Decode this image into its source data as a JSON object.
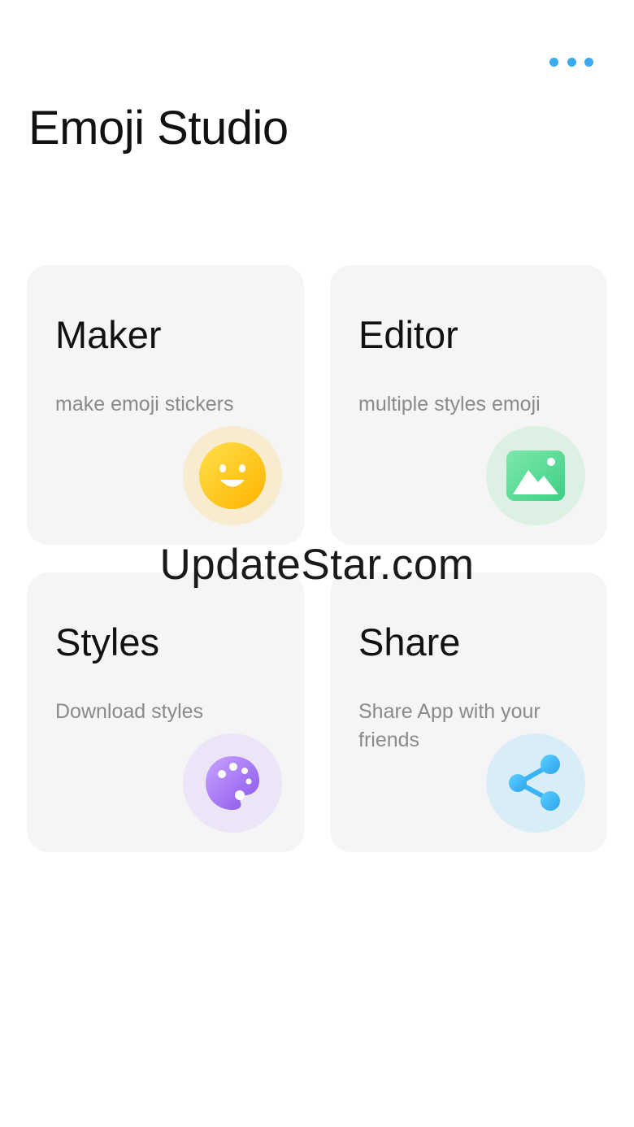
{
  "app": {
    "title": "Emoji Studio",
    "more_icon": "more-horizontal-icon"
  },
  "cards": [
    {
      "title": "Maker",
      "subtitle": "make emoji stickers",
      "icon": "smiley-icon",
      "accent": "#ffc107"
    },
    {
      "title": "Editor",
      "subtitle": "multiple styles emoji",
      "icon": "image-icon",
      "accent": "#5fd896"
    },
    {
      "title": "Styles",
      "subtitle": "Download styles",
      "icon": "palette-icon",
      "accent": "#9b6cf0"
    },
    {
      "title": "Share",
      "subtitle": "Share App with your friends",
      "icon": "share-icon",
      "accent": "#3ab4f2"
    }
  ],
  "watermark": "UpdateStar.com",
  "colors": {
    "background": "#ffffff",
    "card": "#f5f5f5",
    "menu_dots": "#3aa9f0",
    "subtitle": "#8a8a8a"
  }
}
